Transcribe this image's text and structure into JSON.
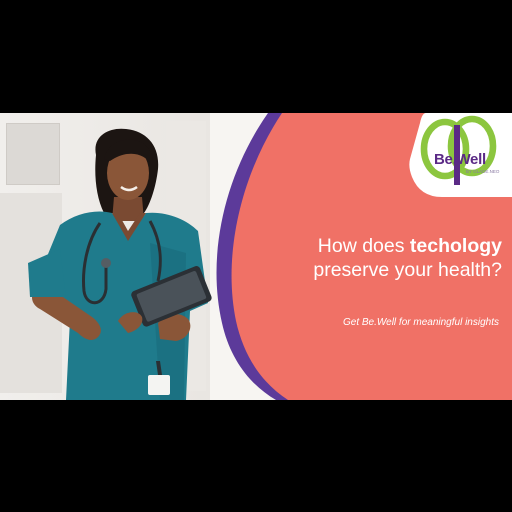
{
  "brand": {
    "name": "Be.Well",
    "sub": "BY GLADE.NEO"
  },
  "headline": {
    "line1_prefix": "How does ",
    "line1_bold": "techology",
    "line2": "preserve your health?"
  },
  "tagline": "Get Be.Well for meaningful insights",
  "colors": {
    "coral": "#f07166",
    "purple_arc": "#5c3a9a",
    "brand_purple": "#5b2a86",
    "brand_green": "#8cc63f",
    "scrubs": "#1f7b8c"
  }
}
